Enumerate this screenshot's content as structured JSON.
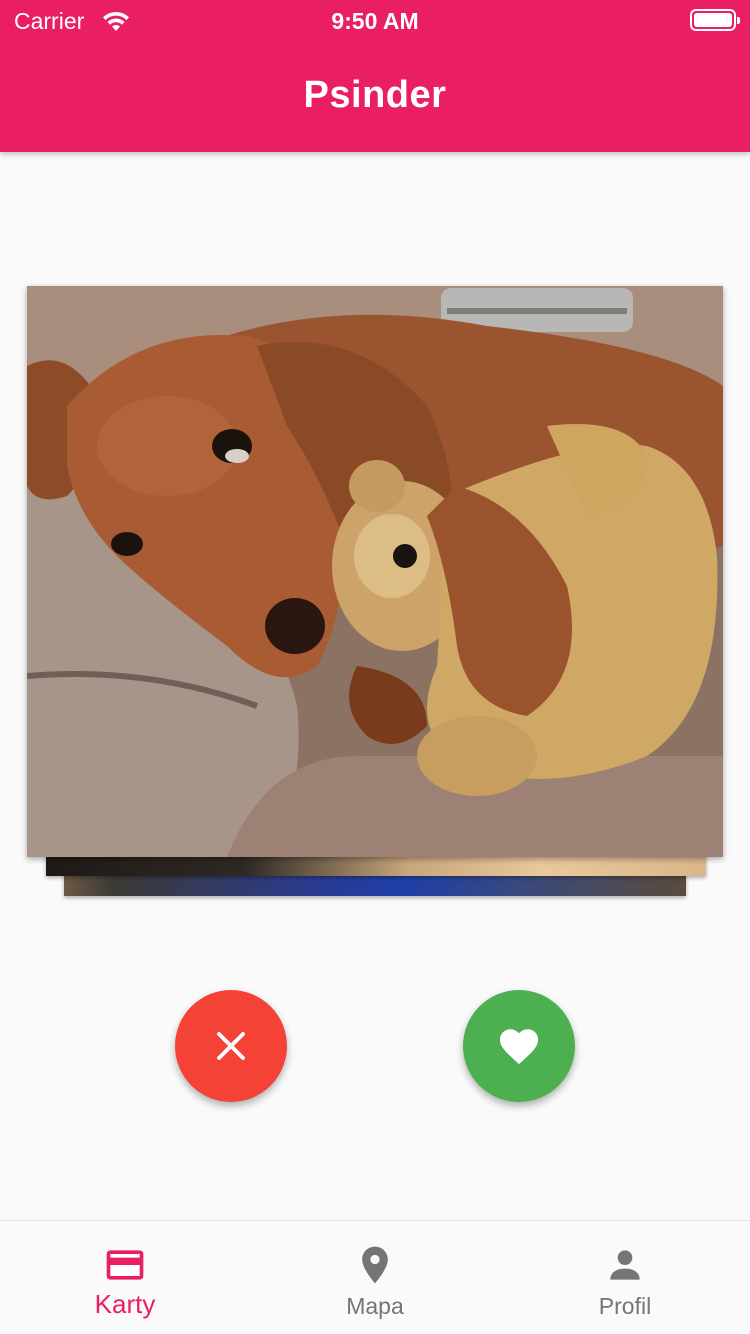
{
  "status_bar": {
    "carrier": "Carrier",
    "time": "9:50 AM"
  },
  "app_bar": {
    "title": "Psinder"
  },
  "card": {
    "image": "dog-with-teddy-bear-photo"
  },
  "actions": {
    "dislike_icon": "close-icon",
    "like_icon": "heart-icon"
  },
  "bottom_nav": {
    "items": [
      {
        "label": "Karty",
        "icon": "card-icon",
        "active": true
      },
      {
        "label": "Mapa",
        "icon": "location-pin-icon",
        "active": false
      },
      {
        "label": "Profil",
        "icon": "person-icon",
        "active": false
      }
    ]
  },
  "colors": {
    "primary": "#e91e63",
    "dislike": "#f44336",
    "like": "#4caf50",
    "inactive": "#757575"
  }
}
